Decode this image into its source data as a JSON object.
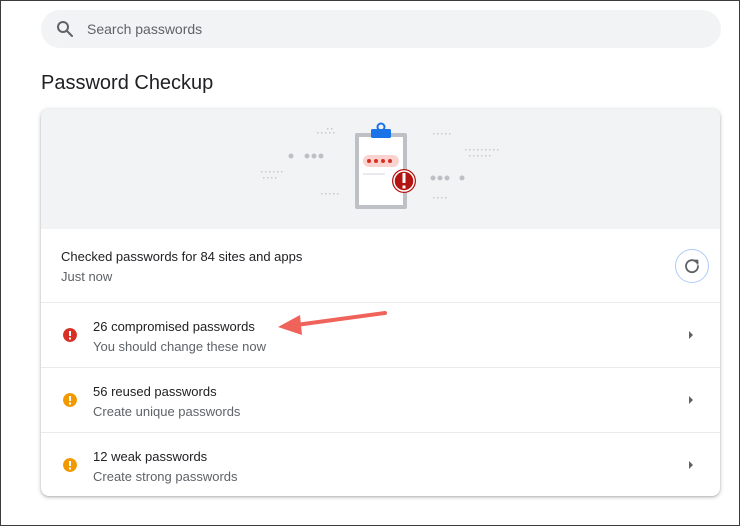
{
  "search": {
    "placeholder": "Search passwords"
  },
  "page": {
    "title": "Password Checkup"
  },
  "status": {
    "checked_text": "Checked passwords for 84 sites and apps",
    "time_text": "Just now"
  },
  "issues": [
    {
      "title": "26 compromised passwords",
      "subtitle": "You should change these now",
      "severity": "error",
      "color": "#d93025"
    },
    {
      "title": "56 reused passwords",
      "subtitle": "Create unique passwords",
      "severity": "warning",
      "color": "#f29900"
    },
    {
      "title": "12 weak passwords",
      "subtitle": "Create strong passwords",
      "severity": "warning",
      "color": "#f29900"
    }
  ],
  "icons": {
    "search": "search-icon",
    "refresh": "refresh-icon",
    "chevron": "chevron-right-icon",
    "illustration": "clipboard-illustration"
  },
  "colors": {
    "accent": "#1a73e8",
    "error": "#d93025",
    "warning": "#f29900",
    "annotation_arrow": "#f0635a"
  }
}
